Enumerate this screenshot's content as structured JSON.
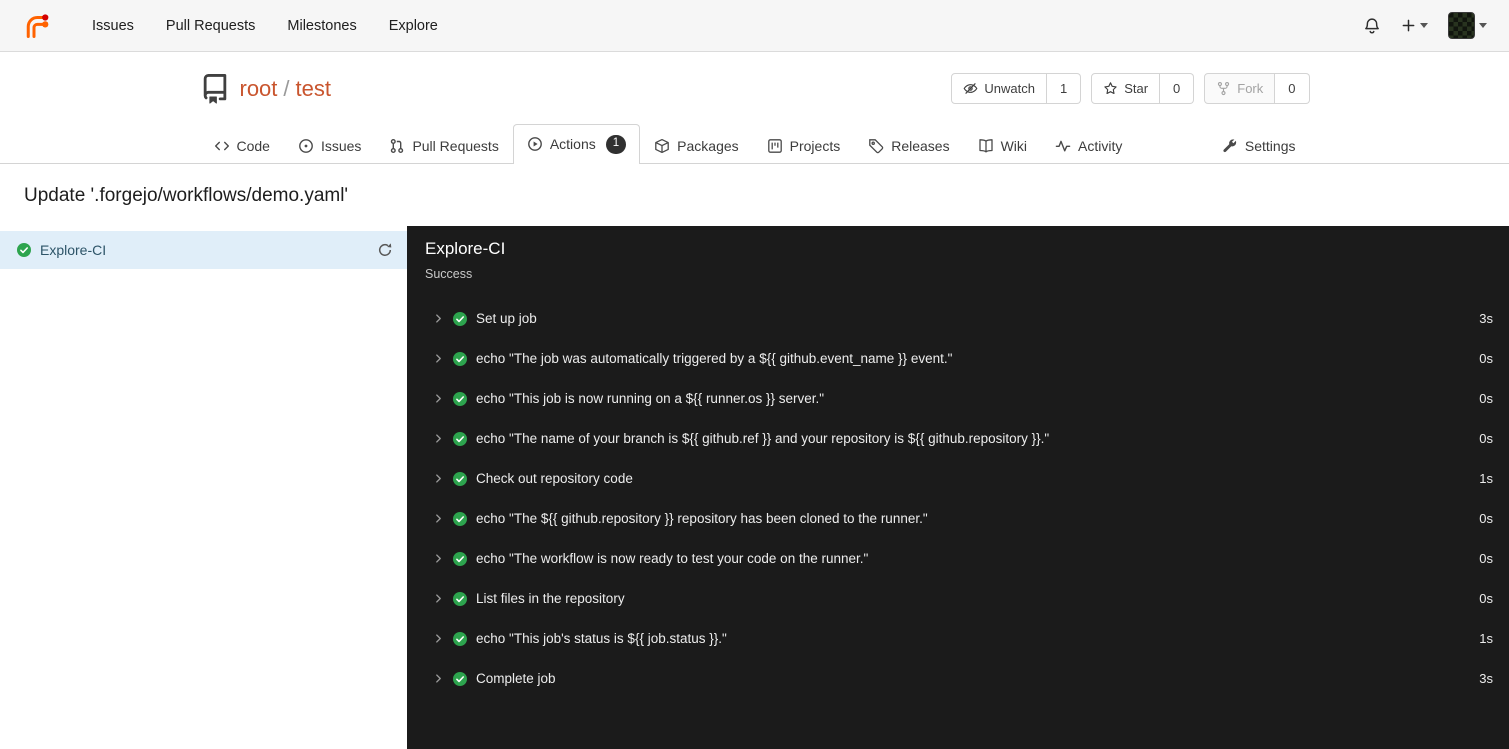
{
  "colors": {
    "accent_orange": "#c9552e",
    "success_green": "#2da44e",
    "dark_panel_bg": "#1b1b1b",
    "active_job_bg": "#e0eef9",
    "topnav_bg": "#f6f6f6"
  },
  "topnav": {
    "items": [
      {
        "label": "Issues"
      },
      {
        "label": "Pull Requests"
      },
      {
        "label": "Milestones"
      },
      {
        "label": "Explore"
      }
    ]
  },
  "repo_header": {
    "owner": "root",
    "separator": "/",
    "name": "test",
    "actions": [
      {
        "label": "Unwatch",
        "count": "1",
        "icon": "eye-slash"
      },
      {
        "label": "Star",
        "count": "0",
        "icon": "star"
      },
      {
        "label": "Fork",
        "count": "0",
        "icon": "fork",
        "disabled": true
      }
    ]
  },
  "tabs": {
    "items": [
      {
        "label": "Code",
        "icon": "code"
      },
      {
        "label": "Issues",
        "icon": "issue"
      },
      {
        "label": "Pull Requests",
        "icon": "pull-request"
      },
      {
        "label": "Actions",
        "icon": "actions",
        "badge": "1",
        "active": true
      },
      {
        "label": "Packages",
        "icon": "package"
      },
      {
        "label": "Projects",
        "icon": "project"
      },
      {
        "label": "Releases",
        "icon": "tag"
      },
      {
        "label": "Wiki",
        "icon": "book"
      },
      {
        "label": "Activity",
        "icon": "activity"
      }
    ],
    "settings": {
      "label": "Settings",
      "icon": "tools"
    }
  },
  "page": {
    "title": "Update '.forgejo/workflows/demo.yaml'"
  },
  "jobs_sidebar": {
    "items": [
      {
        "name": "Explore-CI",
        "status": "success"
      }
    ]
  },
  "run_panel": {
    "job_title": "Explore-CI",
    "job_status": "Success",
    "steps": [
      {
        "name": "Set up job",
        "duration": "3s"
      },
      {
        "name": "echo \"The job was automatically triggered by a ${{ github.event_name }} event.\"",
        "duration": "0s"
      },
      {
        "name": "echo \"This job is now running on a ${{ runner.os }} server.\"",
        "duration": "0s"
      },
      {
        "name": "echo \"The name of your branch is ${{ github.ref }} and your repository is ${{ github.repository }}.\"",
        "duration": "0s"
      },
      {
        "name": "Check out repository code",
        "duration": "1s"
      },
      {
        "name": "echo \"The ${{ github.repository }} repository has been cloned to the runner.\"",
        "duration": "0s"
      },
      {
        "name": "echo \"The workflow is now ready to test your code on the runner.\"",
        "duration": "0s"
      },
      {
        "name": "List files in the repository",
        "duration": "0s"
      },
      {
        "name": "echo \"This job's status is ${{ job.status }}.\"",
        "duration": "1s"
      },
      {
        "name": "Complete job",
        "duration": "3s"
      }
    ]
  }
}
